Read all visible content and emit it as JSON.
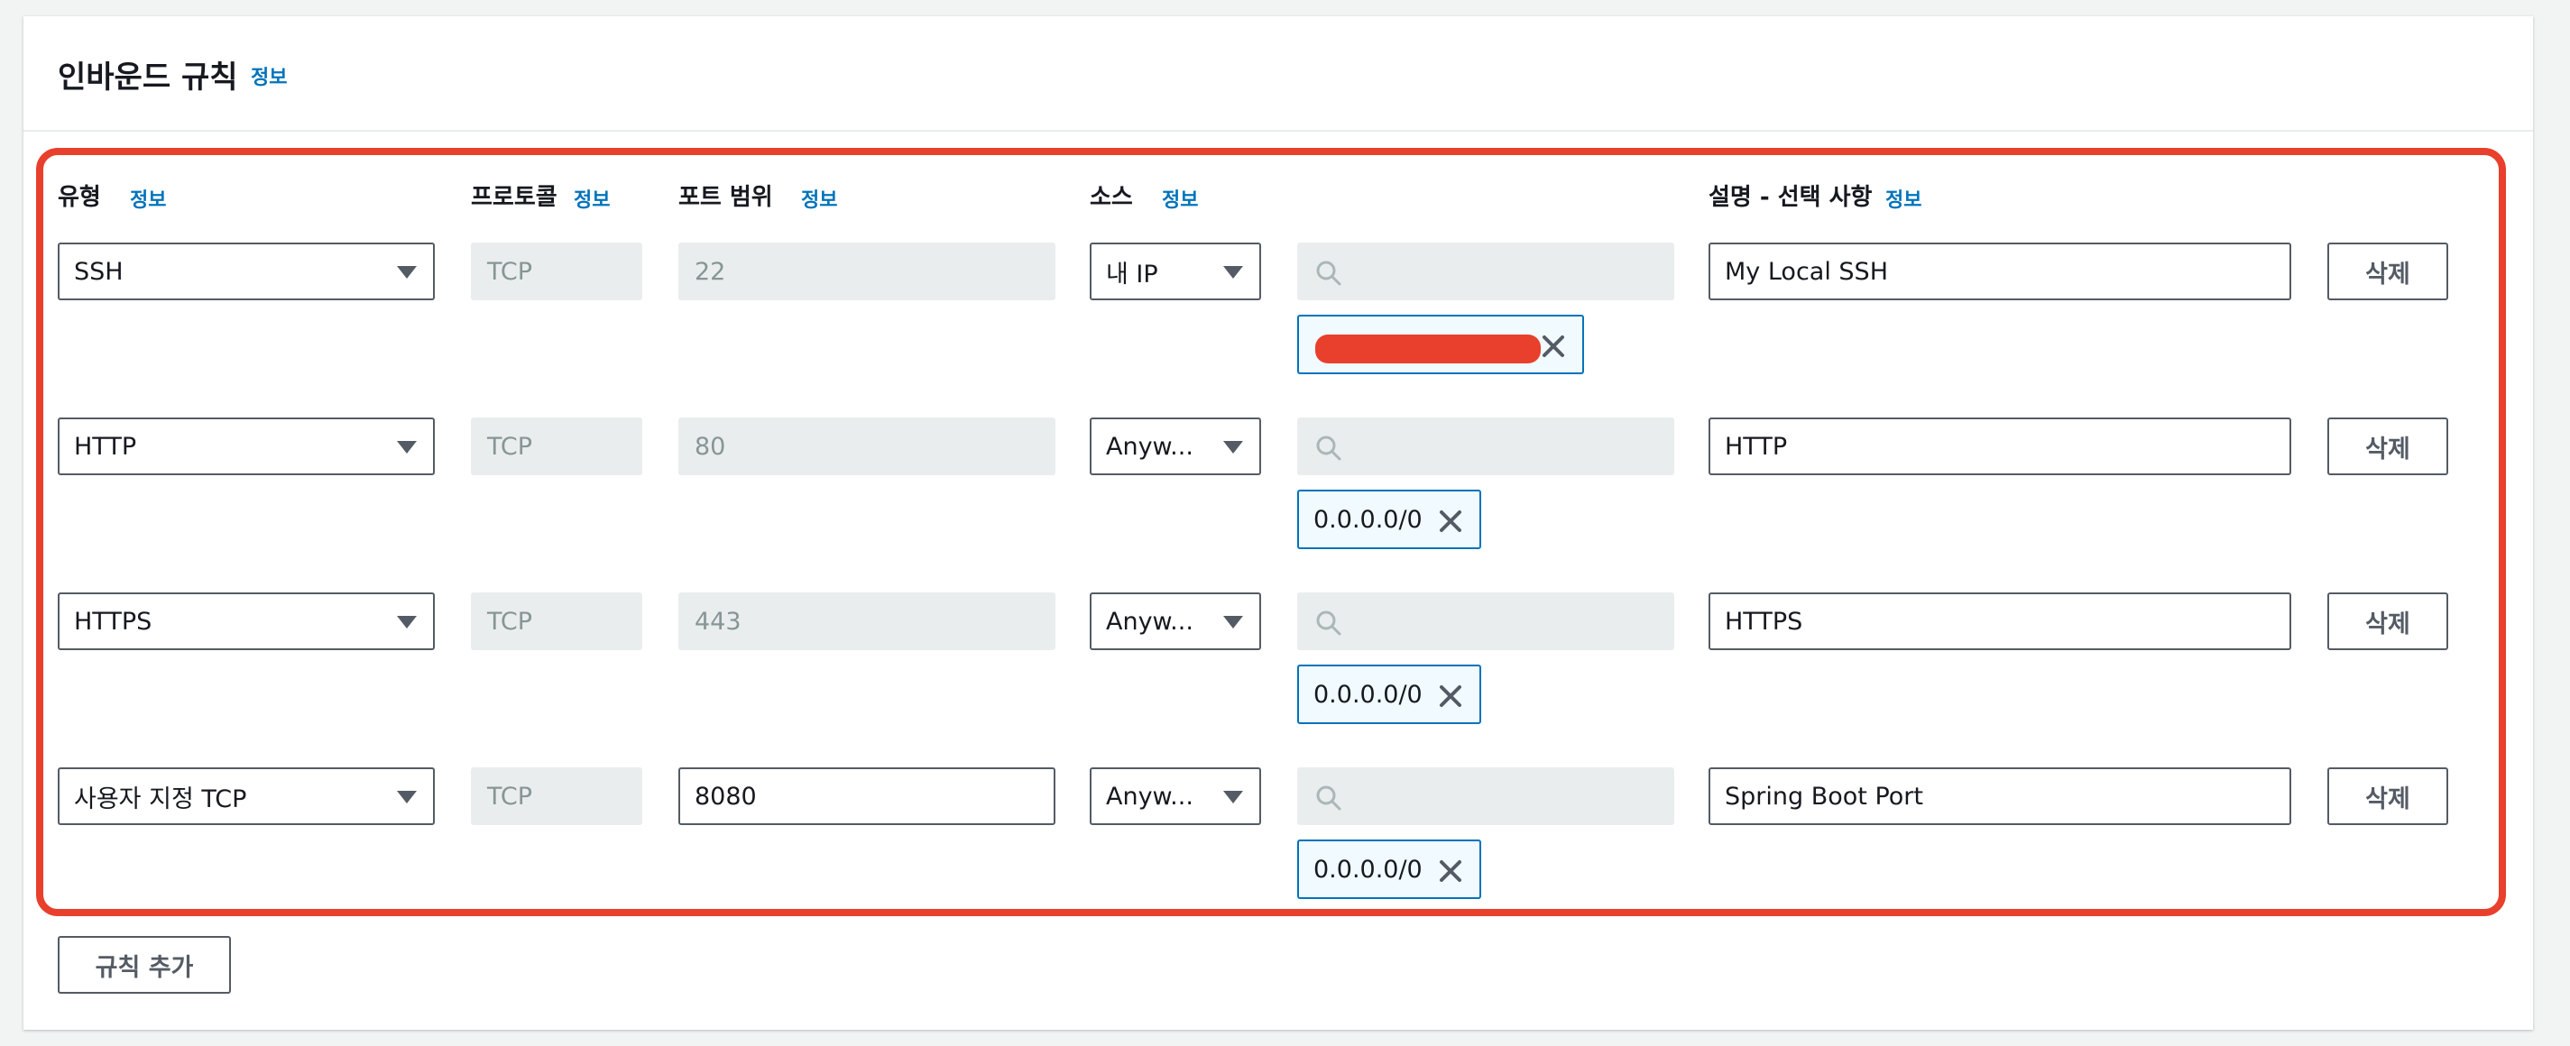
{
  "panel": {
    "title": "인바운드 규칙",
    "info": "정보"
  },
  "columns": {
    "type": {
      "label": "유형",
      "info": "정보"
    },
    "protocol": {
      "label": "프로토콜",
      "info": "정보"
    },
    "port_range": {
      "label": "포트 범위",
      "info": "정보"
    },
    "source": {
      "label": "소스",
      "info": "정보"
    },
    "description": {
      "label": "설명 - 선택 사항",
      "info": "정보"
    }
  },
  "rules": [
    {
      "type": "SSH",
      "protocol": "TCP",
      "port": "22",
      "source": "내 IP",
      "source_value": "",
      "description": "My Local SSH",
      "delete_label": "삭제"
    },
    {
      "type": "HTTP",
      "protocol": "TCP",
      "port": "80",
      "source": "Anyw...",
      "source_value": "0.0.0.0/0",
      "description": "HTTP",
      "delete_label": "삭제"
    },
    {
      "type": "HTTPS",
      "protocol": "TCP",
      "port": "443",
      "source": "Anyw...",
      "source_value": "0.0.0.0/0",
      "description": "HTTPS",
      "delete_label": "삭제"
    },
    {
      "type": "사용자 지정 TCP",
      "protocol": "TCP",
      "port": "8080",
      "source": "Anyw...",
      "source_value": "0.0.0.0/0",
      "description": "Spring Boot Port",
      "delete_label": "삭제"
    }
  ],
  "add_rule_label": "규칙 추가",
  "icons": {
    "search": "search-icon",
    "remove": "close-icon",
    "caret": "caret-down-icon"
  },
  "colors": {
    "info_link": "#0073bb",
    "highlight": "#e8402c",
    "token_border": "#0073bb",
    "disabled_bg": "#eaeded"
  }
}
